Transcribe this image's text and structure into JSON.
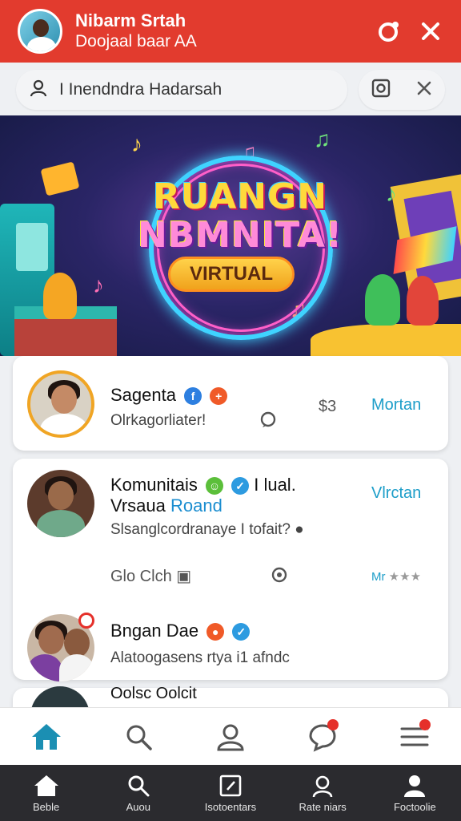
{
  "header": {
    "title": "Nibarm Srtah",
    "subtitle": "Doojaal baar AA"
  },
  "search": {
    "value": "I Inendndra Hadarsah"
  },
  "banner": {
    "title_line1": "RUANGN",
    "title_line2": "NBMNITA!",
    "pill": "VIRTUAL"
  },
  "feed": {
    "card1": {
      "name": "Sagenta",
      "subtitle": "Olrkagorliater!",
      "count": "$3",
      "action": "Mortan"
    },
    "card2": {
      "name_line1": "Komunitais",
      "name_suffix": "I lual.",
      "name_line2_prefix": "Vrsaua",
      "name_line2_accent": "Roand",
      "subtitle": "Slsanglcordranaye I tofait?",
      "action": "Vlrctan",
      "footer_label": "Glo Clch",
      "footer_rating_prefix": "Mr"
    },
    "card3": {
      "name": "Bngan Dae",
      "subtitle": "Alatoogasens rtya i1 afndc"
    },
    "card4": {
      "name": "Oolsc Oolcit"
    }
  },
  "system_nav": [
    {
      "label": "Beble"
    },
    {
      "label": "Auou"
    },
    {
      "label": "Isotoentars"
    },
    {
      "label": "Rate niars"
    },
    {
      "label": "Foctoolie"
    }
  ],
  "colors": {
    "header": "#e23b2e",
    "accent_blue": "#1d9ec9",
    "tab_active": "#1b8fb3",
    "system_bar": "#2b2b2f"
  }
}
